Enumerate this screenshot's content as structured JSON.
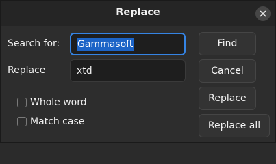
{
  "window": {
    "title": "Replace",
    "close_icon": "close-icon"
  },
  "form": {
    "search_label": "Search for:",
    "search_value": "Gammasoft",
    "replace_label": "Replace",
    "replace_value": "xtd"
  },
  "options": {
    "whole_word_label": "Whole word",
    "whole_word_checked": false,
    "match_case_label": "Match case",
    "match_case_checked": false
  },
  "buttons": {
    "find": "Find",
    "cancel": "Cancel",
    "replace": "Replace",
    "replace_all": "Replace all"
  },
  "colors": {
    "accent": "#3584e4",
    "selection": "#1c64c7",
    "background": "#2d2d2d"
  }
}
